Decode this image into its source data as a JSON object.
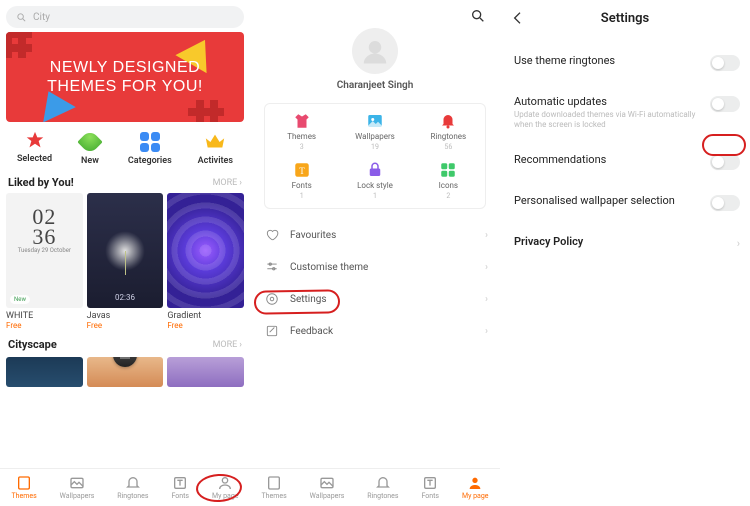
{
  "panel1": {
    "search_placeholder": "City",
    "hero_line1": "Newly Designed",
    "hero_line2": "Themes For You!",
    "tabs": {
      "selected": "Selected",
      "new": "New",
      "categories": "Categories",
      "activities": "Activites"
    },
    "liked_heading": "Liked by You!",
    "more_label": "MORE",
    "themes": [
      {
        "name": "WHITE",
        "price": "Free",
        "clock": "02\n36",
        "clock_sub": "Tuesday 29 October"
      },
      {
        "name": "Javas",
        "price": "Free",
        "clock_bottom": "02:36"
      },
      {
        "name": "Gradient",
        "price": "Free"
      }
    ],
    "cityscape_heading": "Cityscape",
    "nav": {
      "themes": "Themes",
      "wallpapers": "Wallpapers",
      "ringtones": "Ringtones",
      "fonts": "Fonts",
      "mypage": "My page"
    }
  },
  "panel2": {
    "username": "Charanjeet Singh",
    "stats": {
      "themes": {
        "label": "Themes",
        "count": "3"
      },
      "wallpapers": {
        "label": "Wallpapers",
        "count": "19"
      },
      "ringtones": {
        "label": "Ringtones",
        "count": "56"
      },
      "fonts": {
        "label": "Fonts",
        "count": "1"
      },
      "lockstyle": {
        "label": "Lock style",
        "count": "1"
      },
      "icons": {
        "label": "Icons",
        "count": "2"
      }
    },
    "menu": {
      "favourites": "Favourites",
      "customise": "Customise theme",
      "settings": "Settings",
      "feedback": "Feedback"
    },
    "nav": {
      "themes": "Themes",
      "wallpapers": "Wallpapers",
      "ringtones": "Ringtones",
      "fonts": "Fonts",
      "mypage": "My page"
    }
  },
  "panel3": {
    "title": "Settings",
    "rows": {
      "ringtones": "Use theme ringtones",
      "auto_updates": "Automatic updates",
      "auto_updates_desc": "Update downloaded themes via Wi-Fi automatically when the screen is locked",
      "recommendations": "Recommendations",
      "personalised": "Personalised wallpaper selection",
      "privacy": "Privacy Policy"
    }
  }
}
